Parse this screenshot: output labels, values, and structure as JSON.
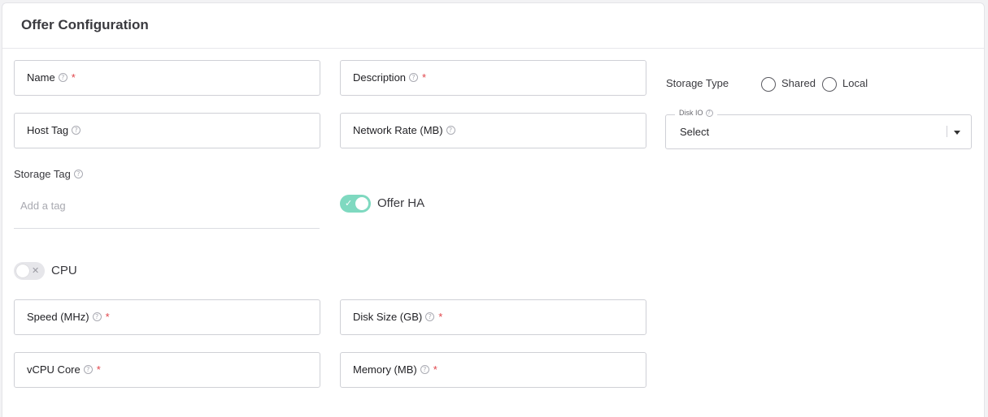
{
  "header": {
    "title": "Offer Configuration"
  },
  "fields": {
    "name": {
      "label": "Name",
      "required": "*"
    },
    "description": {
      "label": "Description",
      "required": "*"
    },
    "host_tag": {
      "label": "Host Tag"
    },
    "network_rate": {
      "label": "Network Rate (MB)"
    },
    "speed": {
      "label": "Speed (MHz)",
      "required": "*"
    },
    "disk_size": {
      "label": "Disk Size (GB)",
      "required": "*"
    },
    "vcpu_core": {
      "label": "vCPU Core",
      "required": "*"
    },
    "memory": {
      "label": "Memory (MB)",
      "required": "*"
    }
  },
  "storage_type": {
    "label": "Storage Type",
    "options": [
      "Shared",
      "Local"
    ],
    "selected": null
  },
  "disk_io": {
    "legend": "Disk IO",
    "value": "Select"
  },
  "storage_tag": {
    "label": "Storage Tag",
    "placeholder": "Add a tag"
  },
  "offer_ha": {
    "label": "Offer HA",
    "enabled": true
  },
  "cpu": {
    "label": "CPU",
    "enabled": false
  },
  "icons": {
    "help": "?",
    "check": "✓",
    "cross": "✕"
  },
  "colors": {
    "toggle_on": "#7fd9c0",
    "required": "#e0454a"
  }
}
